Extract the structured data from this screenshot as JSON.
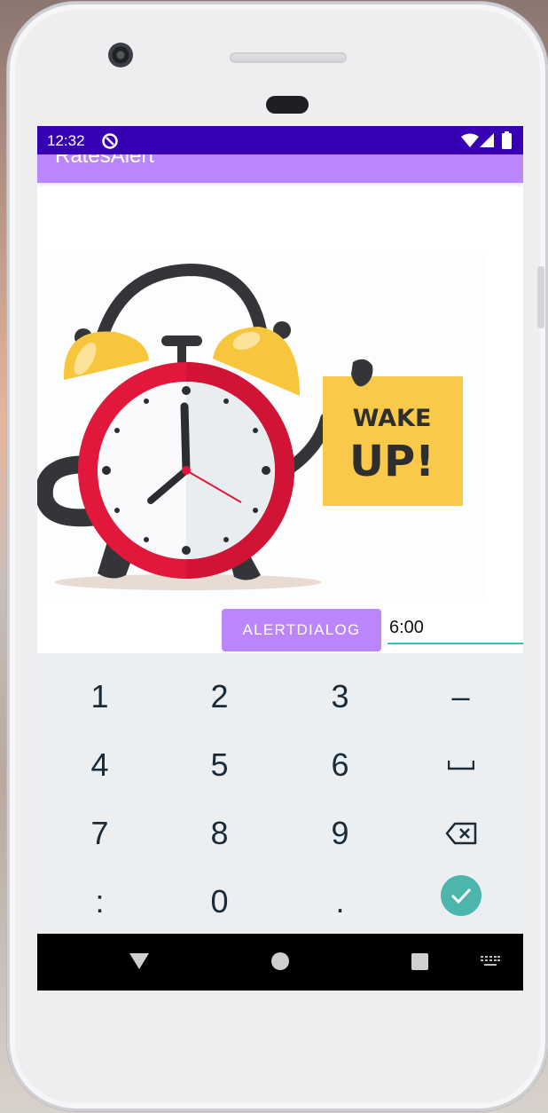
{
  "status_bar": {
    "time": "12:32"
  },
  "app_bar": {
    "title": "RatesAlert"
  },
  "illustration": {
    "sign_line1": "WAKE",
    "sign_line2": "UP!"
  },
  "controls": {
    "alert_button_label": "ALERTDIALOG",
    "time_value": "6:00"
  },
  "keypad": {
    "row1": [
      "1",
      "2",
      "3",
      "–"
    ],
    "row2": [
      "4",
      "5",
      "6"
    ],
    "row3": [
      "7",
      "8",
      "9"
    ],
    "row4": [
      ":",
      "0",
      "."
    ]
  },
  "icons": {
    "status": [
      "data-saver-icon",
      "wifi-icon",
      "cell-signal-icon",
      "battery-icon"
    ],
    "keypad": [
      "space-icon",
      "backspace-icon",
      "check-icon"
    ],
    "nav": [
      "back-icon",
      "home-icon",
      "recents-icon",
      "keyboard-switch-icon"
    ]
  },
  "colors": {
    "status_bar": "#3700b3",
    "app_bar": "#bb86fc",
    "accent": "#26c6bb",
    "check": "#4db6ac"
  }
}
